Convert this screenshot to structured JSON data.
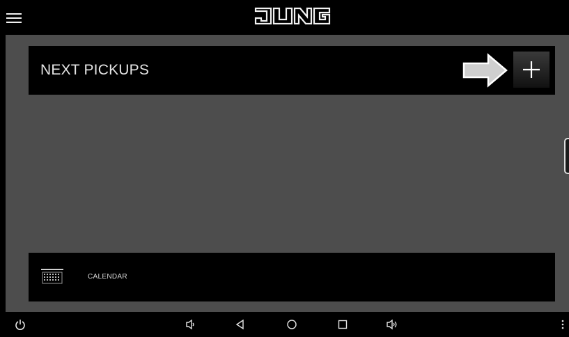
{
  "header": {
    "brand": "JUNG",
    "menu_icon": "hamburger-menu-icon"
  },
  "pickups": {
    "title": "NEXT PICKUPS",
    "add_icon": "plus-icon",
    "hint_icon": "arrow-right-icon"
  },
  "calendar": {
    "label": "CALENDAR",
    "icon": "calendar-icon"
  },
  "navbar": {
    "icons": [
      "power-icon",
      "volume-down-icon",
      "back-icon",
      "home-icon",
      "recents-icon",
      "volume-up-icon",
      "more-vertical-icon"
    ]
  },
  "colors": {
    "background": "#4d4d4d",
    "panel": "#000000",
    "text": "#e4e4e4"
  }
}
